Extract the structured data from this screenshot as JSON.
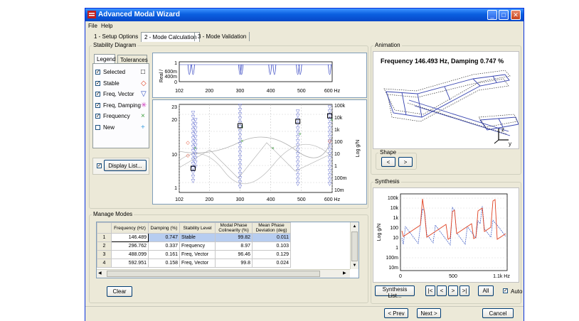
{
  "window": {
    "title": "Advanced Modal Wizard"
  },
  "menu": [
    "File",
    "Help"
  ],
  "tabs": [
    "1 - Setup Options",
    "2 - Mode Calculation",
    "3 - Mode Validation"
  ],
  "stability": {
    "group_label": "Stability Diagram",
    "subtabs": [
      "Legend",
      "Tolerances"
    ],
    "legend": [
      {
        "label": "Selected",
        "checked": true,
        "marker": "□",
        "color": "#000000"
      },
      {
        "label": "Stable",
        "checked": true,
        "marker": "◇",
        "color": "#e04020"
      },
      {
        "label": "Freq, Vector",
        "checked": true,
        "marker": "▽",
        "color": "#3050c0"
      },
      {
        "label": "Freq, Damping",
        "checked": true,
        "marker": "✳",
        "color": "#d040c0"
      },
      {
        "label": "Frequency",
        "checked": true,
        "marker": "×",
        "color": "#40a040"
      },
      {
        "label": "New",
        "checked": false,
        "marker": "+",
        "color": "#40a0e0"
      }
    ],
    "display_list_label": "Display List...",
    "top_plot": {
      "ylabel": "Real /",
      "yticks": [
        "1",
        "600m",
        "400m",
        "0"
      ],
      "xticks": [
        "102",
        "200",
        "300",
        "400",
        "500",
        "600 Hz"
      ]
    },
    "main_plot": {
      "yticks": [
        "23",
        "20",
        "10",
        "1"
      ],
      "right_ylabel": "Log g/N",
      "right_ticks": [
        "100k",
        "10k",
        "1k",
        "100",
        "10",
        "1",
        "100m",
        "10m"
      ],
      "xticks": [
        "102",
        "200",
        "300",
        "400",
        "500",
        "600 Hz"
      ]
    }
  },
  "manage": {
    "group_label": "Manage Modes",
    "columns": [
      "Frequency (Hz)",
      "Damping (%)",
      "Stability Level",
      "Modal Phase Colinearity (%)",
      "Mean Phase Deviation (deg)"
    ],
    "rows": [
      {
        "n": "1",
        "freq": "146.489",
        "damp": "0.747",
        "level": "Stable",
        "mpc": "99.82",
        "mpd": "0.011"
      },
      {
        "n": "2",
        "freq": "296.762",
        "damp": "0.337",
        "level": "Frequency",
        "mpc": "8.97",
        "mpd": "0.103"
      },
      {
        "n": "3",
        "freq": "488.099",
        "damp": "0.161",
        "level": "Freq, Vector",
        "mpc": "96.46",
        "mpd": "0.129"
      },
      {
        "n": "4",
        "freq": "592.951",
        "damp": "0.158",
        "level": "Freq, Vector",
        "mpc": "99.8",
        "mpd": "0.024"
      }
    ],
    "clear_label": "Clear"
  },
  "animation": {
    "group_label": "Animation",
    "title": "Frequency 146.493 Hz, Damping 0.747 %",
    "shape_label": "Shape",
    "prev": "<",
    "next": ">",
    "axes": {
      "z": "z",
      "y": "y"
    }
  },
  "synthesis": {
    "group_label": "Synthesis",
    "ylabel": "Log g/N",
    "yticks": [
      "100k",
      "10k",
      "1k",
      "100",
      "10",
      "1",
      "100m",
      "10m"
    ],
    "xticks": [
      "0",
      "500",
      "1.1k Hz"
    ],
    "list_label": "Synthesis List...",
    "nav": [
      "|<",
      "<",
      ">",
      ">|"
    ],
    "all_label": "All",
    "auto_label": "Auto",
    "auto_checked": true
  },
  "footer": {
    "prev": "< Prev",
    "next": "Next >",
    "cancel": "Cancel"
  }
}
